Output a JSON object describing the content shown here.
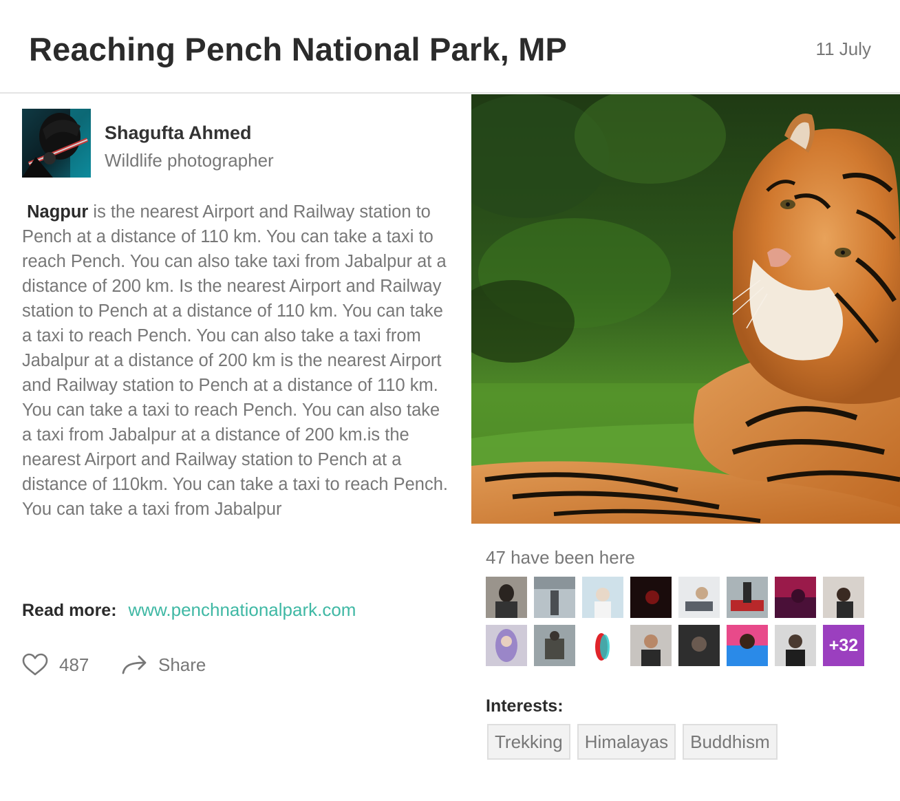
{
  "post": {
    "title": "Reaching Pench National Park, MP",
    "date": "11 July"
  },
  "author": {
    "name": "Shagufta Ahmed",
    "role": "Wildlife photographer"
  },
  "body": {
    "lead": "Nagpur",
    "text": " is the nearest Airport and Railway station to Pench at a distance of 110 km. You can take a taxi to reach Pench. You can also take taxi from Jabalpur at a distance of 200 km. Is the nearest Airport and Railway station to Pench at a distance of 110 km. You can take a taxi to reach Pench. You can also take a taxi from Jabalpur at a distance of 200 km is the nearest Airport and Railway station to Pench at a distance of 110 km. You can take a taxi to reach Pench. You can also take a taxi from Jabalpur at a distance of 200 km.is the nearest Airport and Railway station to Pench at a distance of 110km. You can take a taxi to reach Pench. You can take a taxi from Jabalpur"
  },
  "read_more": {
    "label": "Read more:",
    "url": "www.penchnationalpark.com"
  },
  "actions": {
    "likes": "487",
    "share_label": "Share"
  },
  "visitors": {
    "label": "47 have been here",
    "more": "+32"
  },
  "interests": {
    "label": "Interests:",
    "tags": [
      "Trekking",
      "Himalayas",
      "Buddhism"
    ]
  },
  "colors": {
    "link": "#3fb8a4",
    "more_badge": "#9b3fbf"
  }
}
